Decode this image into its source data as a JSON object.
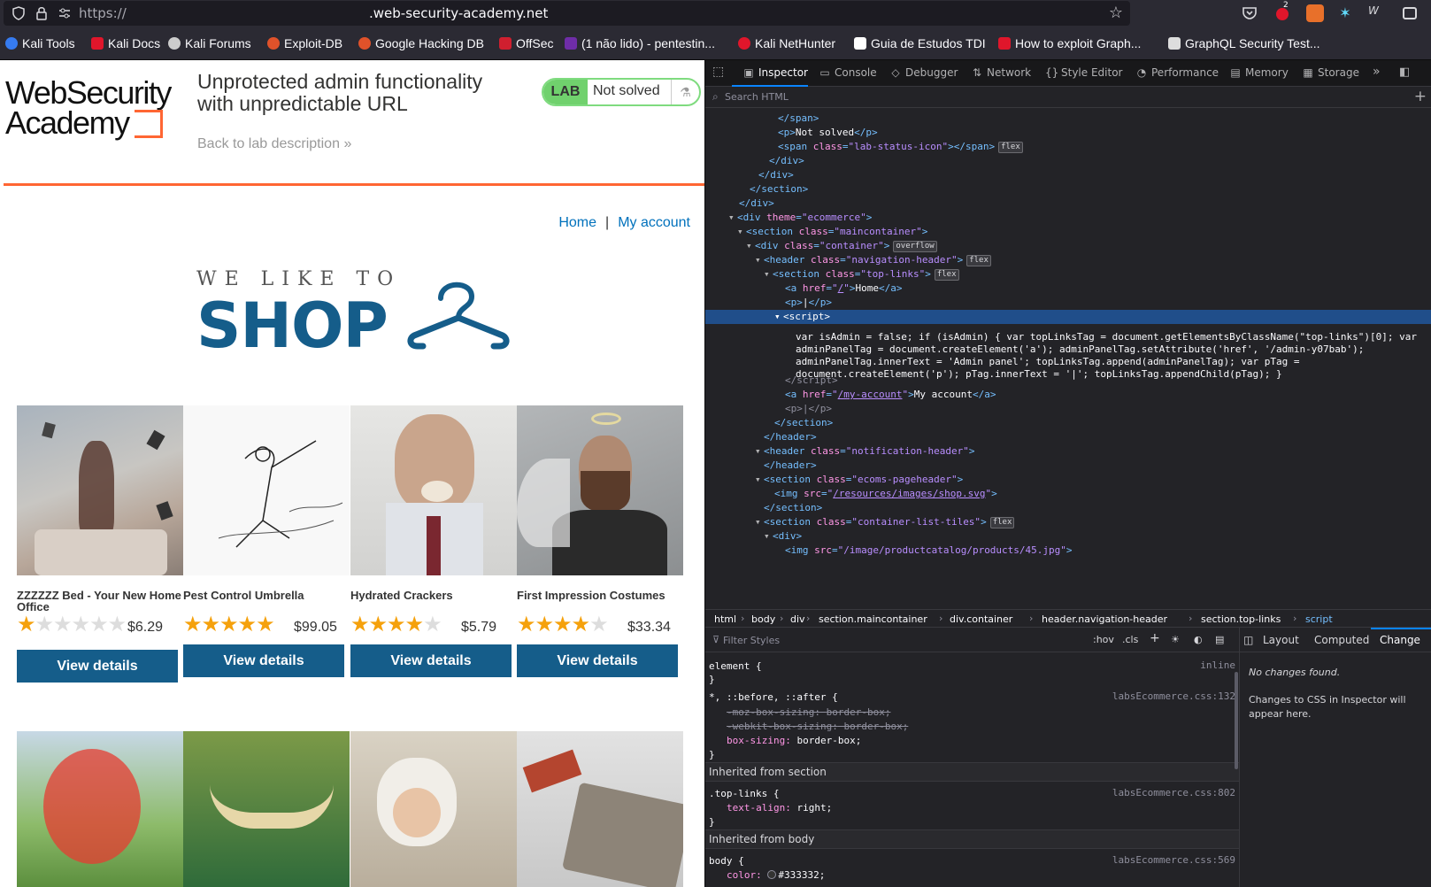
{
  "browser": {
    "url_scheme": "https://",
    "url_host": ".web-security-academy.net",
    "bookmarks": [
      {
        "label": "Kali Tools",
        "color": "#367bf0"
      },
      {
        "label": "Kali Docs",
        "color": "#e0162b"
      },
      {
        "label": "Kali Forums",
        "color": "#cccccc"
      },
      {
        "label": "Exploit-DB",
        "color": "#e0522a"
      },
      {
        "label": "Google Hacking DB",
        "color": "#e0522a"
      },
      {
        "label": "OffSec",
        "color": "#d01f2f"
      },
      {
        "label": "(1 não lido) - pentestin...",
        "color": "#6f2da8"
      },
      {
        "label": "Kali NetHunter",
        "color": "#e0162b"
      },
      {
        "label": "Guia de Estudos TDI",
        "color": "#ffffff"
      },
      {
        "label": "How to exploit Graph...",
        "color": "#e0162b"
      },
      {
        "label": "GraphQL Security Test...",
        "color": "#dddddd"
      }
    ],
    "ext_badge": "2"
  },
  "page": {
    "logo_line1": "WebSecurity",
    "logo_line2": "Academy",
    "lab_title": "Unprotected admin functionality with unpredictable URL",
    "back_link": "Back to lab description",
    "lab_badge": "LAB",
    "lab_status": "Not solved",
    "nav_home": "Home",
    "nav_sep": "|",
    "nav_account": "My account",
    "hero_small": "WE LIKE TO",
    "hero_big": "SHOP",
    "products": [
      {
        "name": "ZZZZZZ Bed - Your New Home Office",
        "price": "$6.29",
        "rating": 1,
        "button": "View details"
      },
      {
        "name": "Pest Control Umbrella",
        "price": "$99.05",
        "rating": 5,
        "button": "View details"
      },
      {
        "name": "Hydrated Crackers",
        "price": "$5.79",
        "rating": 4,
        "button": "View details"
      },
      {
        "name": "First Impression Costumes",
        "price": "$33.34",
        "rating": 4,
        "button": "View details"
      }
    ]
  },
  "devtools": {
    "tabs": [
      "Inspector",
      "Console",
      "Debugger",
      "Network",
      "Style Editor",
      "Performance",
      "Memory",
      "Storage"
    ],
    "search_placeholder": "Search HTML",
    "script_text": "var isAdmin = false; if (isAdmin) { var topLinksTag = document.getElementsByClassName(\"top-links\")[0]; var adminPanelTag = document.createElement('a'); adminPanelTag.setAttribute('href', '/admin-y07bab'); adminPanelTag.innerText = 'Admin panel'; topLinksTag.append(adminPanelTag); var pTag = document.createElement('p'); pTag.innerText = '|'; topLinksTag.appendChild(pTag); }",
    "breadcrumbs": [
      "html",
      "body",
      "div",
      "section.maincontainer",
      "div.container",
      "header.navigation-header",
      "section.top-links",
      "script"
    ],
    "filter_placeholder": "Filter Styles",
    "hov": ":hov",
    "cls": ".cls",
    "side_tabs": [
      "Layout",
      "Computed",
      "Change"
    ],
    "no_changes": "No changes found.",
    "changes_hint": "Changes to CSS in Inspector will appear here."
  }
}
